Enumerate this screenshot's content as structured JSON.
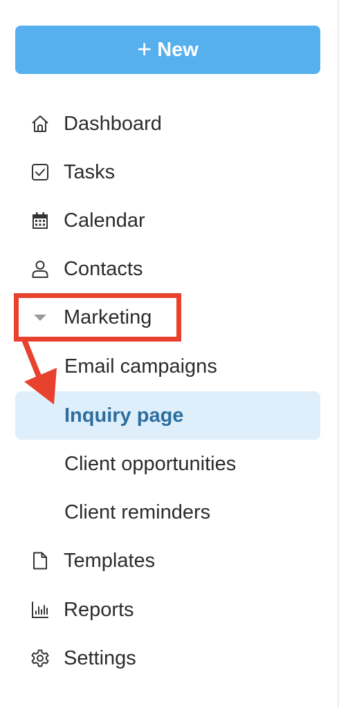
{
  "new_button": {
    "plus": "+",
    "label": "New"
  },
  "nav": {
    "dashboard": "Dashboard",
    "tasks": "Tasks",
    "calendar": "Calendar",
    "contacts": "Contacts",
    "marketing": "Marketing",
    "templates": "Templates",
    "reports": "Reports",
    "settings": "Settings"
  },
  "marketing_submenu": {
    "email_campaigns": "Email campaigns",
    "inquiry_page": "Inquiry page",
    "client_opportunities": "Client opportunities",
    "client_reminders": "Client reminders"
  },
  "colors": {
    "primary_button": "#56b0ee",
    "active_bg": "#deeefb",
    "active_text": "#2c6e9e",
    "annotation": "#e8412d"
  },
  "icons": {
    "dashboard": "home-icon",
    "tasks": "checkbox-icon",
    "calendar": "calendar-icon",
    "contacts": "person-icon",
    "marketing": "caret-down-icon",
    "templates": "file-icon",
    "reports": "bar-chart-icon",
    "settings": "gear-icon"
  }
}
